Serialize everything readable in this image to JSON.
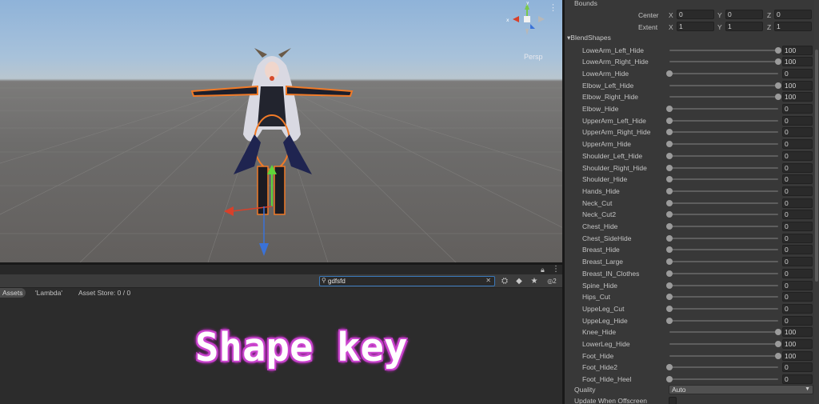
{
  "scene": {
    "persp_label": "Persp",
    "axis_labels": {
      "y": "y",
      "x": "x",
      "z": "z"
    },
    "menu_icon": "ellipsis-icon"
  },
  "project": {
    "search": {
      "value": "gdfsfd",
      "placeholder": ""
    },
    "hidden_count": "2",
    "filters": {
      "assets": "Assets",
      "lambda": "'Lambda'",
      "store": "Asset Store: 0 / 0"
    },
    "overlay_title": "Shape key"
  },
  "inspector": {
    "bounds": {
      "header": "Bounds",
      "center_label": "Center",
      "extent_label": "Extent",
      "axes": [
        "X",
        "Y",
        "Z"
      ],
      "center": [
        "0",
        "0",
        "0"
      ],
      "extent": [
        "1",
        "1",
        "1"
      ]
    },
    "blendshapes_header": "BlendShapes",
    "blendshapes": [
      {
        "name": "LoweArm_Left_Hide",
        "value": "100"
      },
      {
        "name": "LoweArm_Right_Hide",
        "value": "100"
      },
      {
        "name": "LoweArm_Hide",
        "value": "0"
      },
      {
        "name": "Elbow_Left_Hide",
        "value": "100"
      },
      {
        "name": "Elbow_Right_Hide",
        "value": "100"
      },
      {
        "name": "Elbow_Hide",
        "value": "0"
      },
      {
        "name": "UpperArm_Left_Hide",
        "value": "0"
      },
      {
        "name": "UpperArm_Right_Hide",
        "value": "0"
      },
      {
        "name": "UpperArm_Hide",
        "value": "0"
      },
      {
        "name": "Shoulder_Left_Hide",
        "value": "0"
      },
      {
        "name": "Shoulder_Right_Hide",
        "value": "0"
      },
      {
        "name": "Shoulder_Hide",
        "value": "0"
      },
      {
        "name": "Hands_Hide",
        "value": "0"
      },
      {
        "name": "Neck_Cut",
        "value": "0"
      },
      {
        "name": "Neck_Cut2",
        "value": "0"
      },
      {
        "name": "Chest_Hide",
        "value": "0"
      },
      {
        "name": "Chest_SideHide",
        "value": "0"
      },
      {
        "name": "Breast_Hide",
        "value": "0"
      },
      {
        "name": "Breast_Large",
        "value": "0"
      },
      {
        "name": "Breast_IN_Clothes",
        "value": "0"
      },
      {
        "name": "Spine_Hide",
        "value": "0"
      },
      {
        "name": "Hips_Cut",
        "value": "0"
      },
      {
        "name": "UppeLeg_Cut",
        "value": "0"
      },
      {
        "name": "UppeLeg_Hide",
        "value": "0"
      },
      {
        "name": "Knee_Hide",
        "value": "100"
      },
      {
        "name": "LowerLeg_Hide",
        "value": "100"
      },
      {
        "name": "Foot_Hide",
        "value": "100"
      },
      {
        "name": "Foot_Hide2",
        "value": "0"
      },
      {
        "name": "Foot_Hide_Heel",
        "value": "0"
      }
    ],
    "slider_max": 100,
    "quality_label": "Quality",
    "quality_value": "Auto",
    "offscreen_label": "Update When Offscreen"
  }
}
